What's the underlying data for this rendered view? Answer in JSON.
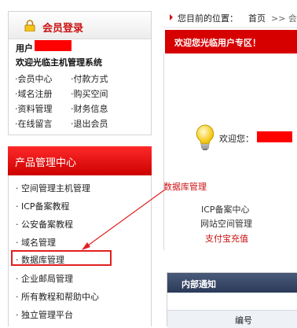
{
  "member": {
    "title": "会员登录",
    "user_label": "用户",
    "welcome": "欢迎光临主机管理系统",
    "links": [
      {
        "label": "·会员中心"
      },
      {
        "label": "·付款方式"
      },
      {
        "label": "·域名注册"
      },
      {
        "label": "·购买空间"
      },
      {
        "label": "·资料管理"
      },
      {
        "label": "·财务信息"
      },
      {
        "label": "·在线留言"
      },
      {
        "label": "·退出会员"
      }
    ]
  },
  "product": {
    "title": "产品管理中心",
    "items": [
      {
        "label": "· 空间管理主机管理"
      },
      {
        "label": "· ICP备案教程"
      },
      {
        "label": "· 公安备案教程"
      },
      {
        "label": "· 域名管理"
      },
      {
        "label": "· 数据库管理"
      },
      {
        "label": "· 企业邮局管理"
      },
      {
        "label": "· 所有教程和帮助中心"
      },
      {
        "label": "· 独立管理平台"
      }
    ]
  },
  "breadcrumb": {
    "prefix": "您目前的位置：",
    "home": "首页",
    "sep": ">> 会"
  },
  "welcome_bar": "欢迎您光临用户专区！",
  "greeting": "欢迎您：",
  "annotation": "数据库管理",
  "right_links": {
    "icp": "ICP备案中心",
    "space": "网站空间管理",
    "alipay": "支付宝充值"
  },
  "notice": {
    "title": "内部通知",
    "column": "编号"
  },
  "colors": {
    "accent": "#d60000",
    "highlight": "#e02020",
    "notice_header": "#2b3a58"
  }
}
